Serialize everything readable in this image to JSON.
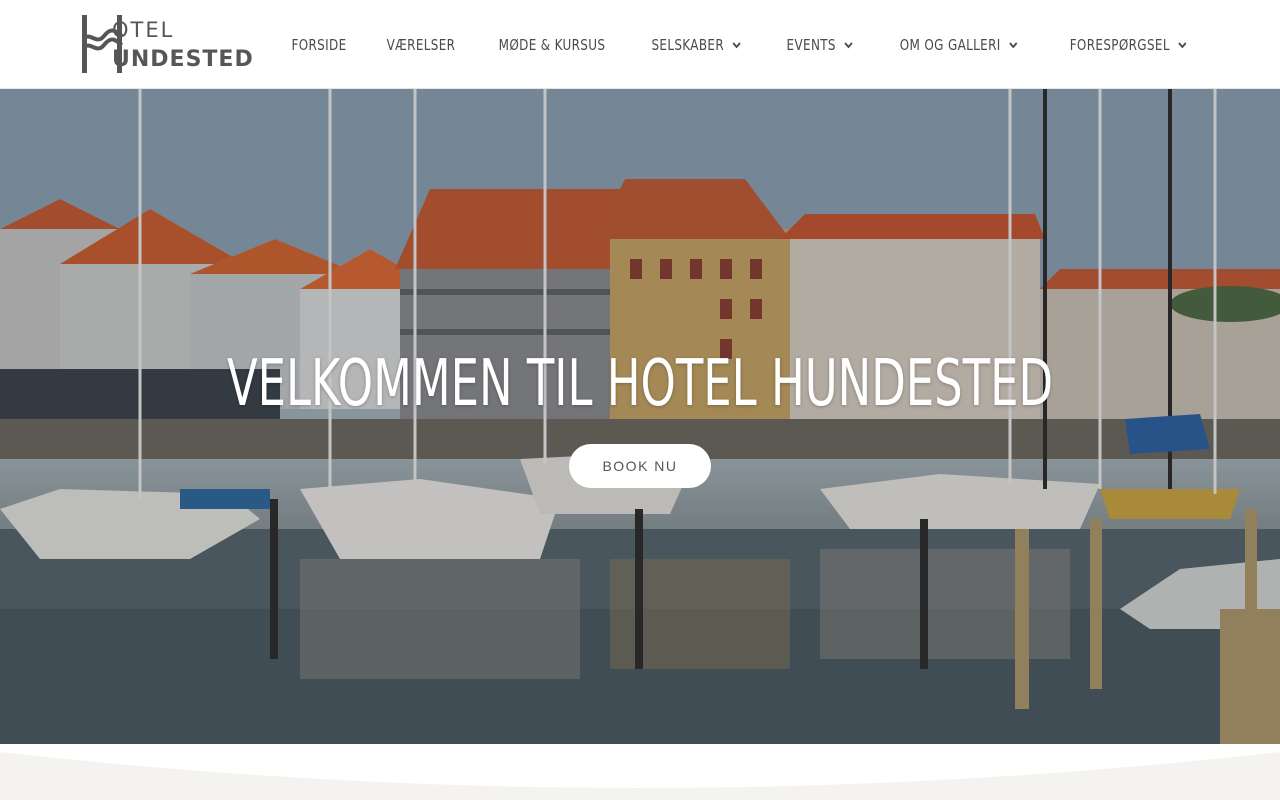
{
  "logo": {
    "top_text": "OTEL",
    "bottom_text": "UNDESTED"
  },
  "nav": {
    "items": [
      {
        "label": "FORSIDE",
        "has_dropdown": false
      },
      {
        "label": "VÆRELSER",
        "has_dropdown": false
      },
      {
        "label": "MØDE & KURSUS",
        "has_dropdown": false
      },
      {
        "label": "SELSKABER",
        "has_dropdown": true
      },
      {
        "label": "EVENTS",
        "has_dropdown": true
      },
      {
        "label": "OM OG GALLERI",
        "has_dropdown": true
      },
      {
        "label": "FORESPØRGSEL",
        "has_dropdown": true
      }
    ],
    "dropdown_icon": "chevron-down-icon"
  },
  "hero": {
    "title": "VELKOMMEN TIL HOTEL HUNDESTED",
    "button_label": "BOOK NU"
  },
  "colors": {
    "nav_text": "#4a4a4a",
    "logo": "#565656",
    "hero_text": "#ffffff",
    "button_bg": "#ffffff",
    "button_text": "#555555",
    "page_bottom": "#f4f3ef"
  }
}
